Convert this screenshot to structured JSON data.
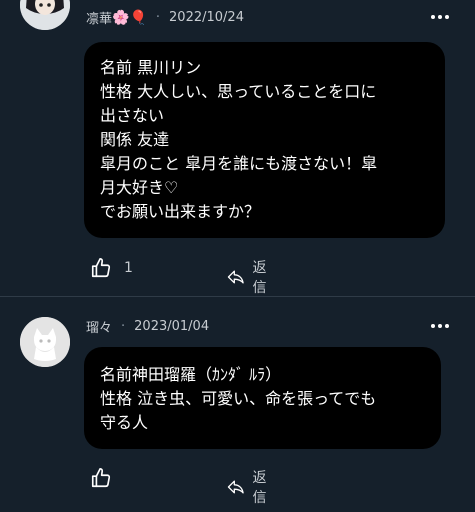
{
  "comments": [
    {
      "username": "凛華",
      "emojis": "🌸🎈",
      "separator": "·",
      "date": "2022/10/24",
      "lines": [
        "名前  黒川リン",
        "性格  大人しい、思っていることを口に",
        "出さない",
        "関係  友達",
        "皐月のこと  皐月を誰にも渡さない！皐",
        "月大好き♡",
        "でお願い出来ますか？"
      ],
      "like_count": "1",
      "reply_label": "返信"
    },
    {
      "username": "瑠々",
      "separator": "·",
      "date": "2023/01/04",
      "lines": [
        "名前神田瑠羅（ｶﾝﾀﾞ ﾙﾗ）",
        "性格 泣き虫、可愛い、命を張ってでも",
        "守る人"
      ],
      "reply_label": "返信"
    }
  ],
  "colors": {
    "background": "#15202b",
    "bubble": "#000000",
    "meta_text": "#c7ccd1",
    "divider": "#2f3b47"
  },
  "icons": [
    "more-icon",
    "thumbs-up-icon",
    "reply-arrow-icon"
  ]
}
